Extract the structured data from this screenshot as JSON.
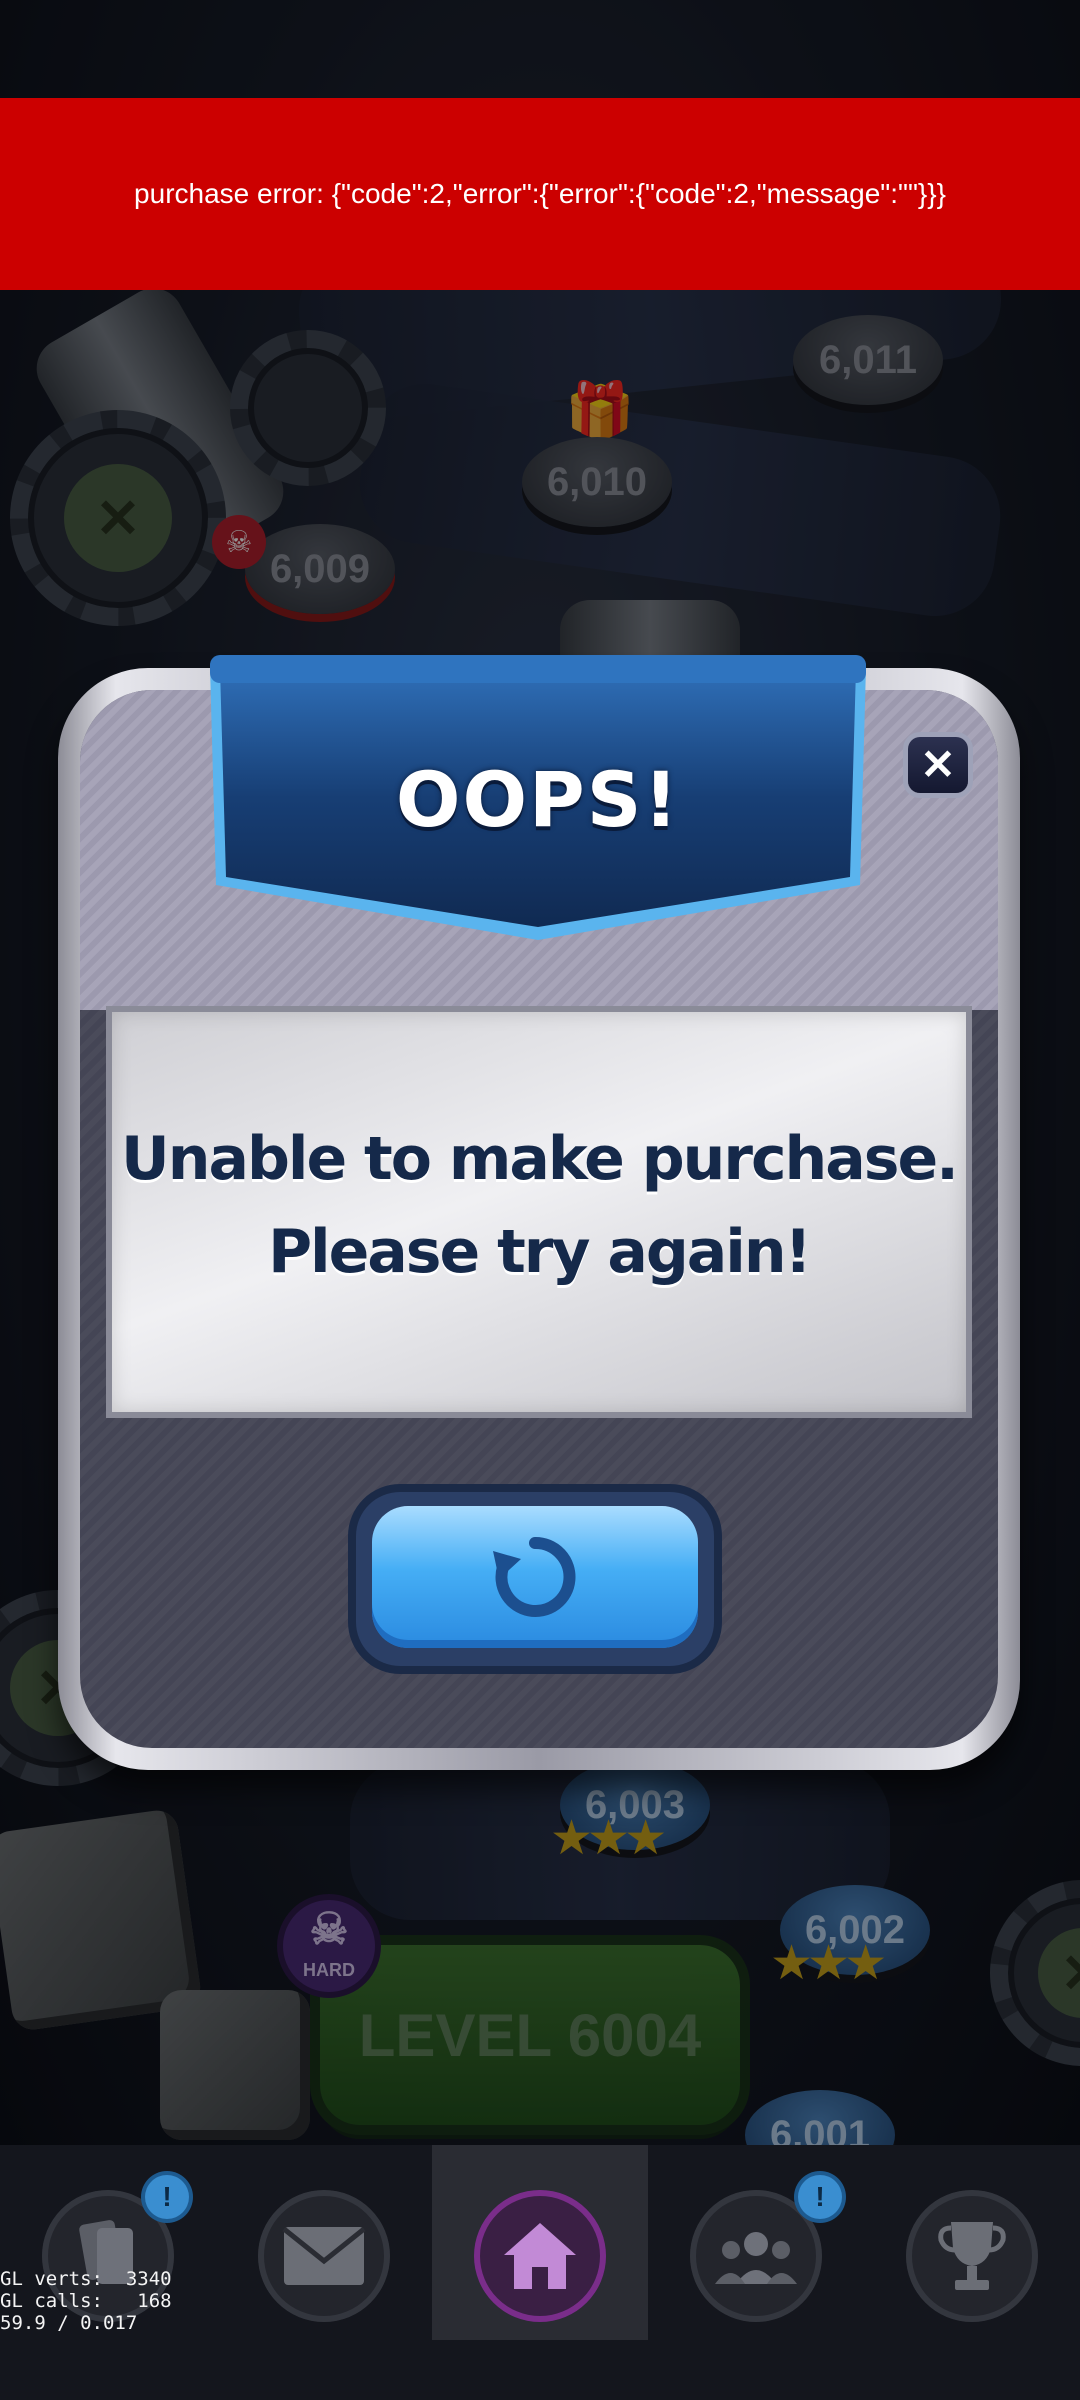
{
  "error_banner": {
    "text": "purchase error: {\"code\":2,\"error\":{\"error\":{\"code\":2,\"message\":\"\"}}}",
    "color": "#cc0000"
  },
  "map": {
    "nodes": [
      {
        "label": "6,011",
        "style": "locked"
      },
      {
        "label": "6,010",
        "style": "locked"
      },
      {
        "label": "6,009",
        "style": "locked-hard"
      },
      {
        "label": "6,003",
        "style": "completed"
      },
      {
        "label": "6,002",
        "style": "completed"
      },
      {
        "label": "6,001",
        "style": "completed"
      }
    ],
    "level_button": "LEVEL 6004",
    "hard_badge": "HARD"
  },
  "dialog": {
    "title": "OOPS!",
    "message_line1": "Unable to make purchase.",
    "message_line2": "Please try again!",
    "close_icon": "close-icon",
    "retry_icon": "retry-icon"
  },
  "bottom_nav": {
    "items": [
      {
        "icon": "cards-icon",
        "has_notification": true,
        "notification": "!"
      },
      {
        "icon": "mail-icon",
        "has_notification": false
      },
      {
        "icon": "home-icon",
        "active": true
      },
      {
        "icon": "team-icon",
        "has_notification": true,
        "notification": "!"
      },
      {
        "icon": "trophy-icon",
        "has_notification": false
      }
    ]
  },
  "debug": {
    "line1": "GL verts:  3340",
    "line2": "GL calls:   168",
    "line3": "59.9 / 0.017"
  }
}
